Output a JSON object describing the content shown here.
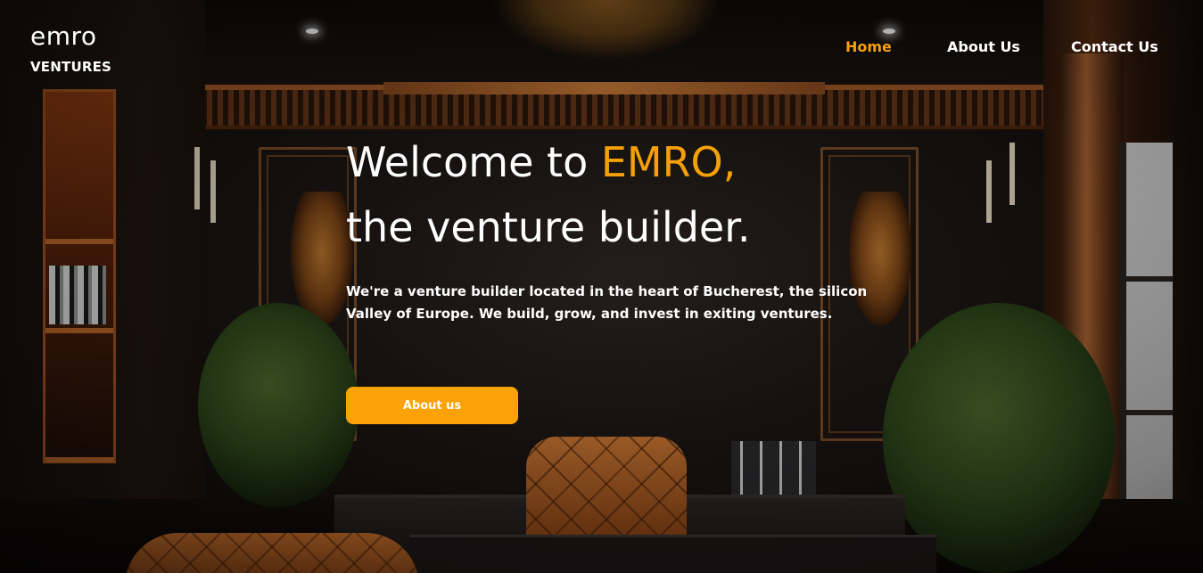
{
  "brand": {
    "name": "emro",
    "subtitle": "VENTURES"
  },
  "nav": {
    "items": [
      {
        "label": "Home",
        "active": true
      },
      {
        "label": "About Us",
        "active": false
      },
      {
        "label": "Contact Us",
        "active": false
      }
    ]
  },
  "hero": {
    "headline_prefix": "Welcome to ",
    "headline_accent": "EMRO,",
    "headline_line2": "the venture builder.",
    "lead": "We're a venture builder located in the heart of Bucherest, the silicon Valley of Europe. We build, grow, and invest in exiting ventures.",
    "cta_label": "About us"
  },
  "colors": {
    "accent": "#f5a00a",
    "button": "#fba207",
    "text": "#ffffff"
  }
}
